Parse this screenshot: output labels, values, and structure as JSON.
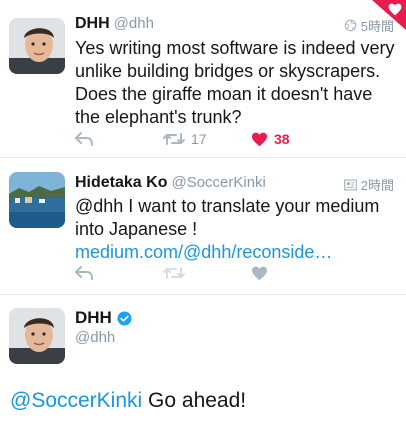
{
  "tweets": [
    {
      "name": "DHH",
      "handle": "@dhh",
      "time": "5時間",
      "text": "Yes writing most software is indeed very unlike building bridges or skyscrapers. Does the giraffe moan it doesn't have the elephant's trunk?",
      "retweets": "17",
      "likes": "38",
      "liked": true
    },
    {
      "name": "Hidetaka Ko",
      "handle": "@SoccerKinki",
      "time": "2時間",
      "text_prefix": "@dhh I want to translate your medium into Japanese ! ",
      "link": "medium.com/@dhh/reconside…"
    },
    {
      "name": "DHH",
      "handle": "@dhh",
      "verified": true,
      "mention": "@SoccerKinki",
      "reply_text": " Go ahead!"
    }
  ],
  "colors": {
    "accent": "#1b95e0",
    "like": "#e81c4f",
    "muted": "#8899a6"
  }
}
